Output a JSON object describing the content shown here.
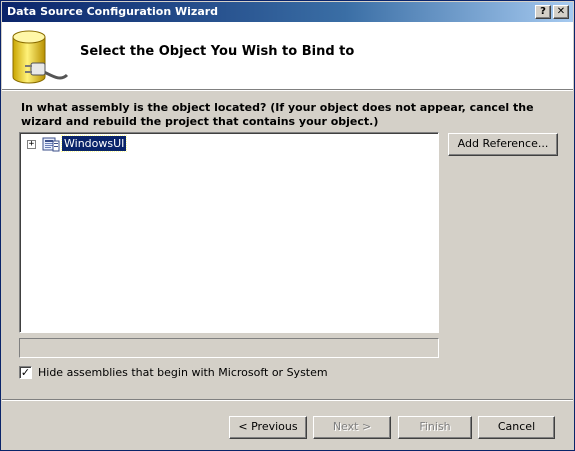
{
  "window": {
    "title": "Data Source Configuration Wizard",
    "help_glyph": "?",
    "close_glyph": "✕"
  },
  "header": {
    "title": "Select the Object You Wish to Bind to",
    "icon": "database-plug-icon"
  },
  "prompt": "In what assembly is the object located? (If your object does not appear, cancel the wizard and rebuild the project that contains your object.)",
  "tree": {
    "items": [
      {
        "label": "WindowsUI",
        "expander": "+",
        "icon": "assembly-icon",
        "selected": true
      }
    ]
  },
  "buttons": {
    "add_reference": "Add Reference...",
    "previous": "< Previous",
    "next": "Next >",
    "finish": "Finish",
    "cancel": "Cancel"
  },
  "checkbox": {
    "label": "Hide assemblies that begin with Microsoft or System",
    "checked": true,
    "mark": "✓"
  },
  "colors": {
    "title_bar": "#0a246a",
    "dialog_bg": "#d4d0c8",
    "selection": "#0a246a"
  }
}
